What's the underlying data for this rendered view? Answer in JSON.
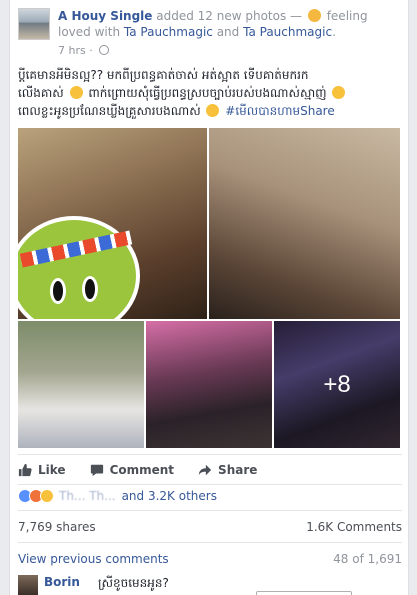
{
  "post": {
    "author": "A Houy Single",
    "action": "added 12 new photos —",
    "feeling": "feeling loved",
    "with_prefix": "with",
    "tag1": "Ta Pauchmagic",
    "and": "and",
    "tag2": "Ta Pauchmagic",
    "period": ".",
    "time": "7 hrs ·",
    "text_line1": "ប្តីគេមានអីមិនល្អ?? មកពីប្រពន្ធគាត់ចាស់ អត់ស្អាត ទើបគាត់មករក",
    "text_line2": "លើងគាស់",
    "text_line2b": "ពាក់ព្រោយសុំធ្វើប្រពន្ធស្របច្បាប់របស់បងណាស់ស្មាញ់",
    "text_line3": "ពេលខ្លះអូនប្រណែនឃ្លីងគ្រួសារបងណាស់",
    "hashtag": "#មើលបានហាមShare",
    "more_count": "+8"
  },
  "actions": {
    "like": "Like",
    "comment": "Comment",
    "share": "Share"
  },
  "reactions": {
    "names_blurred": "Th... Th...",
    "others": "and 3.2K others"
  },
  "stats": {
    "shares": "7,769 shares",
    "comments": "1.6K Comments"
  },
  "comments_nav": {
    "view_previous": "View previous comments",
    "count": "48 of 1,691"
  },
  "comment": {
    "name": "Borin",
    "text": "ស្រីខូចមេនអូន?"
  },
  "colors": {
    "link": "#365899",
    "muted": "#90949c",
    "like_blue": "#5890ff"
  }
}
